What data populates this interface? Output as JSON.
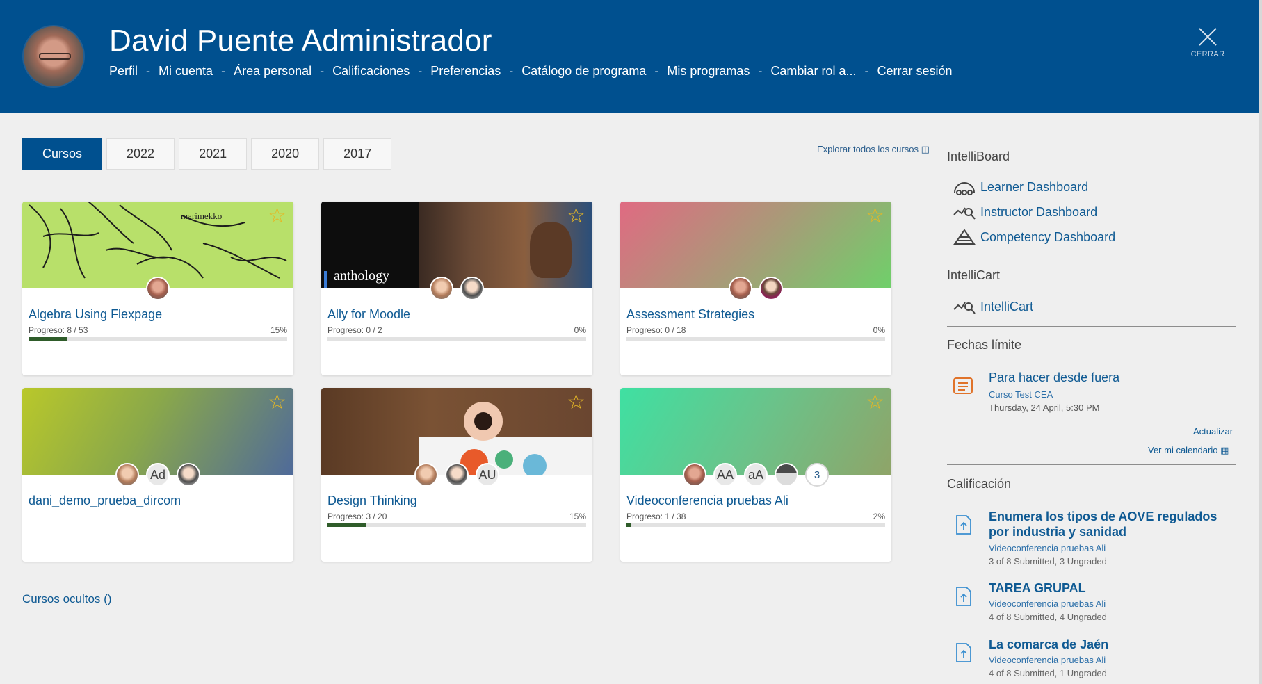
{
  "header": {
    "user_name": "David Puente Administrador",
    "menu": [
      "Perfil",
      "Mi cuenta",
      "Área personal",
      "Calificaciones",
      "Preferencias",
      "Catálogo de programa",
      "Mis programas",
      "Cambiar rol a...",
      "Cerrar sesión"
    ],
    "separator": "-",
    "close_label": "CERRAR"
  },
  "tabs": [
    "Cursos",
    "2022",
    "2021",
    "2020",
    "2017"
  ],
  "explore_all": "Explorar todos los cursos",
  "courses": [
    {
      "title": "Algebra Using Flexpage",
      "progress_label": "Progreso: 8 / 53",
      "progress_pct": "15%",
      "progress_value": 15,
      "banner_text": "marimekko"
    },
    {
      "title": "Ally for Moodle",
      "progress_label": "Progreso: 0 / 2",
      "progress_pct": "0%",
      "progress_value": 0,
      "banner_text": "anthology"
    },
    {
      "title": "Assessment Strategies",
      "progress_label": "Progreso: 0 / 18",
      "progress_pct": "0%",
      "progress_value": 0
    },
    {
      "title": "dani_demo_prueba_dircom",
      "avatar_letters": [
        "Ad"
      ]
    },
    {
      "title": "Design Thinking",
      "progress_label": "Progreso: 3 / 20",
      "progress_pct": "15%",
      "progress_value": 15,
      "avatar_letters": [
        "AU"
      ]
    },
    {
      "title": "Videoconferencia pruebas Ali",
      "progress_label": "Progreso: 1 / 38",
      "progress_pct": "2%",
      "progress_value": 2,
      "avatar_letters": [
        "AA",
        "aA"
      ],
      "more_count": "3"
    }
  ],
  "hidden_courses": "Cursos ocultos ()",
  "sidebar": {
    "intelliboard_title": "IntelliBoard",
    "intelliboard_links": [
      "Learner Dashboard",
      "Instructor Dashboard",
      "Competency Dashboard"
    ],
    "intellicart_title": "IntelliCart",
    "intellicart_link": "IntelliCart",
    "deadlines_title": "Fechas límite",
    "deadline": {
      "title": "Para hacer desde fuera",
      "course": "Curso Test CEA",
      "date": "Thursday, 24 April, 5:30 PM"
    },
    "refresh": "Actualizar",
    "calendar": "Ver mi calendario",
    "grading_title": "Calificación",
    "grading": [
      {
        "title": "Enumera los tipos de AOVE regulados por industria y sanidad",
        "course": "Videoconferencia pruebas Ali",
        "stat": "3 of 8 Submitted, 3 Ungraded"
      },
      {
        "title": "TAREA GRUPAL",
        "course": "Videoconferencia pruebas Ali",
        "stat": "4 of 8 Submitted, 4 Ungraded"
      },
      {
        "title": "La comarca de Jaén",
        "course": "Videoconferencia pruebas Ali",
        "stat": "4 of 8 Submitted, 1 Ungraded"
      }
    ]
  },
  "colors": {
    "header_bg": "#00508f",
    "link": "#0f5a93",
    "star": "#e4b726",
    "progress_fill": "#2f5c2a"
  }
}
